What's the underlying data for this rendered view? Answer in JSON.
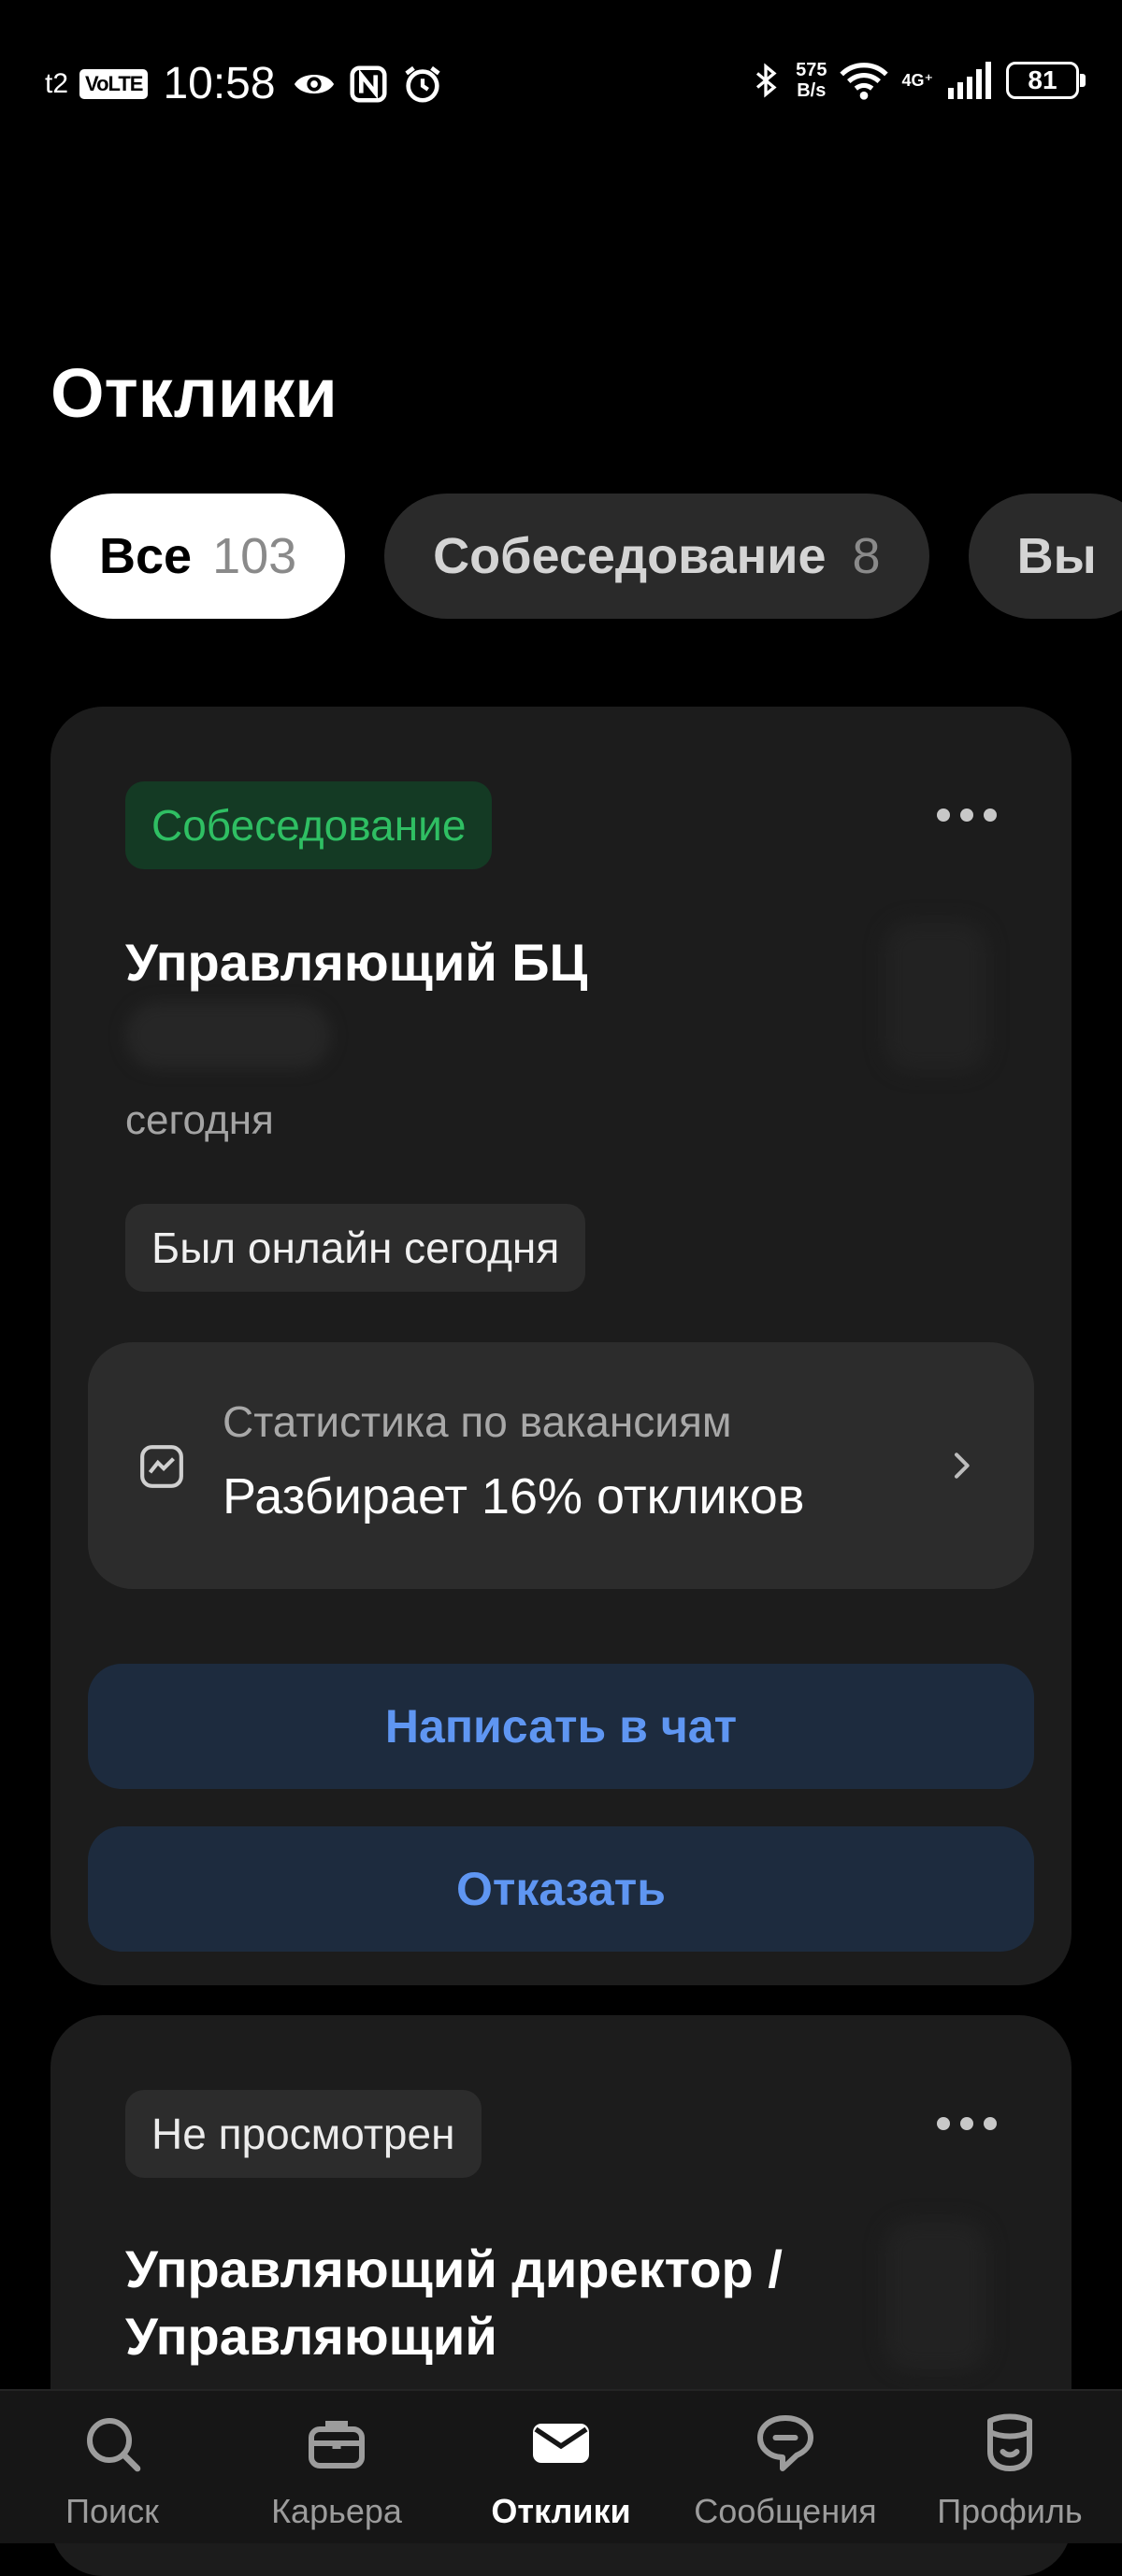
{
  "status_bar": {
    "carrier": "t2",
    "volte": "VoLTE",
    "time": "10:58",
    "net_speed_value": "575",
    "net_speed_unit": "B/s",
    "network_type": "4G⁺",
    "battery": "81"
  },
  "page": {
    "title": "Отклики"
  },
  "tabs": [
    {
      "label": "Все",
      "count": "103",
      "active": true
    },
    {
      "label": "Собеседование",
      "count": "8",
      "active": false
    },
    {
      "label": "Вы",
      "count": "",
      "active": false
    }
  ],
  "cards": [
    {
      "status": "Собеседование",
      "title": "Управляющий БЦ",
      "date": "сегодня",
      "online": "Был онлайн сегодня",
      "stats_caption": "Статистика по вакансиям",
      "stats_value": "Разбирает 16% откликов",
      "chat_button": "Написать в чат",
      "reject_button": "Отказать"
    },
    {
      "status": "Не просмотрен",
      "title": "Управляющий директор / Управляющий"
    }
  ],
  "bottom_nav": [
    {
      "label": "Поиск",
      "icon": "search-icon",
      "active": false
    },
    {
      "label": "Карьера",
      "icon": "briefcase-icon",
      "active": false
    },
    {
      "label": "Отклики",
      "icon": "envelope-icon",
      "active": true
    },
    {
      "label": "Сообщения",
      "icon": "chat-bubble-icon",
      "active": false
    },
    {
      "label": "Профиль",
      "icon": "profile-face-icon",
      "active": false
    }
  ],
  "colors": {
    "accent_blue": "#5f96f2",
    "status_green": "#2fbf63",
    "card_bg": "#1c1c1c"
  }
}
